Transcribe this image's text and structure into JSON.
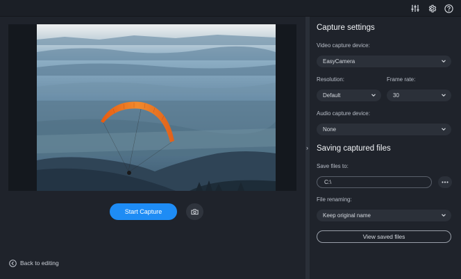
{
  "topbar": {
    "icons": [
      "equalizer-icon",
      "gear-icon",
      "help-icon"
    ]
  },
  "preview": {
    "description_icon": "paraglider-photo"
  },
  "actions": {
    "start_capture": "Start Capture",
    "snapshot_icon": "camera-icon",
    "back_label": "Back to editing"
  },
  "capture": {
    "title": "Capture settings",
    "video_label": "Video capture device:",
    "video_value": "EasyCamera",
    "resolution_label": "Resolution:",
    "resolution_value": "Default",
    "framerate_label": "Frame rate:",
    "framerate_value": "30",
    "audio_label": "Audio capture device:",
    "audio_value": "None"
  },
  "saving": {
    "title": "Saving captured files",
    "save_label": "Save files to:",
    "save_path": "C:\\",
    "renaming_label": "File renaming:",
    "renaming_value": "Keep original name",
    "view_button": "View saved files"
  },
  "colors": {
    "accent": "#1e8cf5",
    "background": "#1f232b",
    "panel_field": "#2b3039"
  }
}
